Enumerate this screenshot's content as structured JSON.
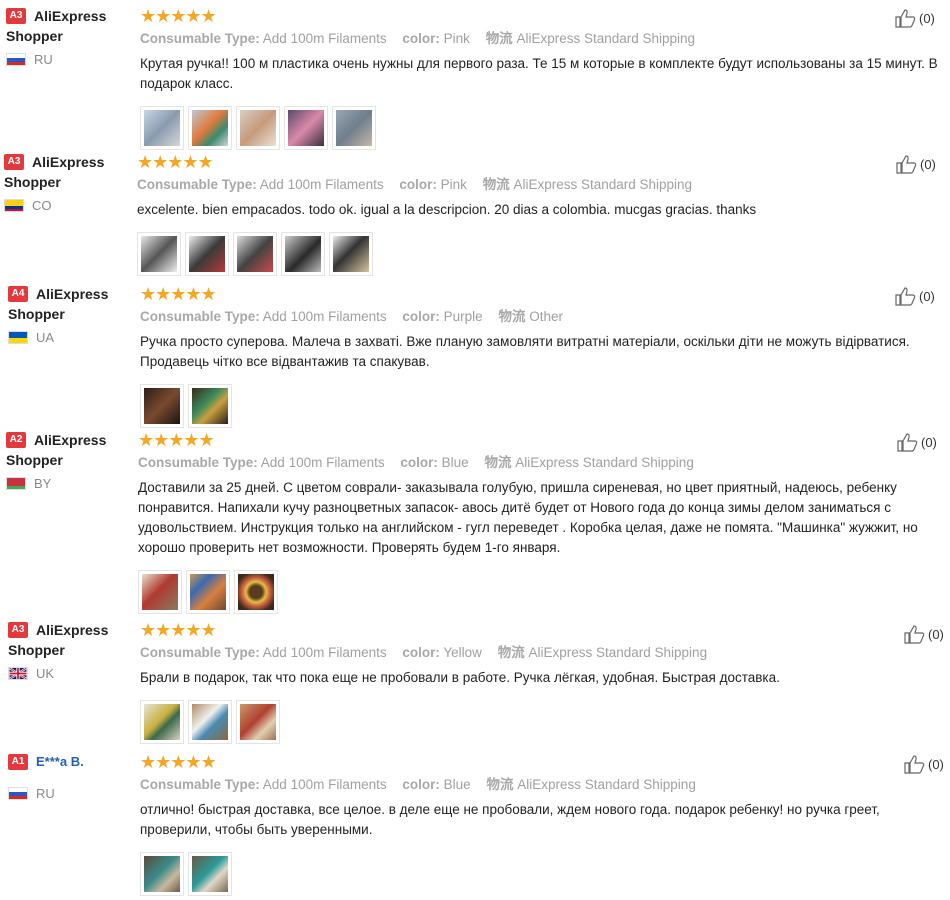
{
  "labels": {
    "consumable_type": "Consumable Type:",
    "color": "color:",
    "shipping": "物流"
  },
  "reviews": [
    {
      "level": "A3",
      "name_line1": "AliExpress",
      "name_line2": "Shopper",
      "country": "RU",
      "stars": "★★★★★",
      "consumable": "Add 100m Filaments",
      "color": "Pink",
      "shipping": "AliExpress Standard Shipping",
      "text": "Крутая ручка!! 100 м пластика очень нужны для первого раза. Те 15 м которые в комплекте будут использованы за 15 минут. В подарок класс.",
      "helpful": "(0)"
    },
    {
      "level": "A3",
      "name_line1": "AliExpress",
      "name_line2": "Shopper",
      "country": "CO",
      "stars": "★★★★★",
      "consumable": "Add 100m Filaments",
      "color": "Pink",
      "shipping": "AliExpress Standard Shipping",
      "text": "excelente. bien empacados. todo ok. igual a la descripcion. 20 dias a colombia. mucgas gracias. thanks",
      "helpful": "(0)"
    },
    {
      "level": "A4",
      "name_line1": "AliExpress",
      "name_line2": "Shopper",
      "country": "UA",
      "stars": "★★★★★",
      "consumable": "Add 100m Filaments",
      "color": "Purple",
      "shipping": "Other",
      "text": "Ручка просто суперова. Малеча в захваті. Вже планую замовляти витратні матеріали, оскільки діти не можуть відірватися. Продавець чітко все відвантажив та спакував.",
      "helpful": "(0)"
    },
    {
      "level": "A2",
      "name_line1": "AliExpress",
      "name_line2": "Shopper",
      "country": "BY",
      "stars": "★★★★★",
      "consumable": "Add 100m Filaments",
      "color": "Blue",
      "shipping": "AliExpress Standard Shipping",
      "text": "Доставили за 25 дней. С цветом соврали- заказывала голубую, пришла сиреневая, но цвет приятный, надеюсь, ребенку понравится. Напихали кучу разноцветных запасок- авось дитё будет от Нового года до конца зимы делом заниматься с удовольствием. Инструкция только на английском - гугл переведет . Коробка целая, даже не помята. \"Машинка\" жужжит, но хорошо проверить нет возможности. Проверять будем 1-го января.",
      "helpful": "(0)"
    },
    {
      "level": "A3",
      "name_line1": "AliExpress",
      "name_line2": "Shopper",
      "country": "UK",
      "stars": "★★★★★",
      "consumable": "Add 100m Filaments",
      "color": "Yellow",
      "shipping": "AliExpress Standard Shipping",
      "text": "Брали в подарок, так что пока еще не пробовали в работе. Ручка лёгкая, удобная. Быстрая доставка.",
      "helpful": "(0)"
    },
    {
      "level": "A1",
      "name_line1": "E***a B.",
      "name_line2": "",
      "country": "RU",
      "stars": "★★★★★",
      "consumable": "Add 100m Filaments",
      "color": "Blue",
      "shipping": "AliExpress Standard Shipping",
      "text": "отлично! быстрая доставка, все целое. в деле еще не пробовали, ждем нового года. подарок ребенку! но ручка греет, проверили, чтобы быть уверенными.",
      "helpful": "(0)"
    }
  ]
}
